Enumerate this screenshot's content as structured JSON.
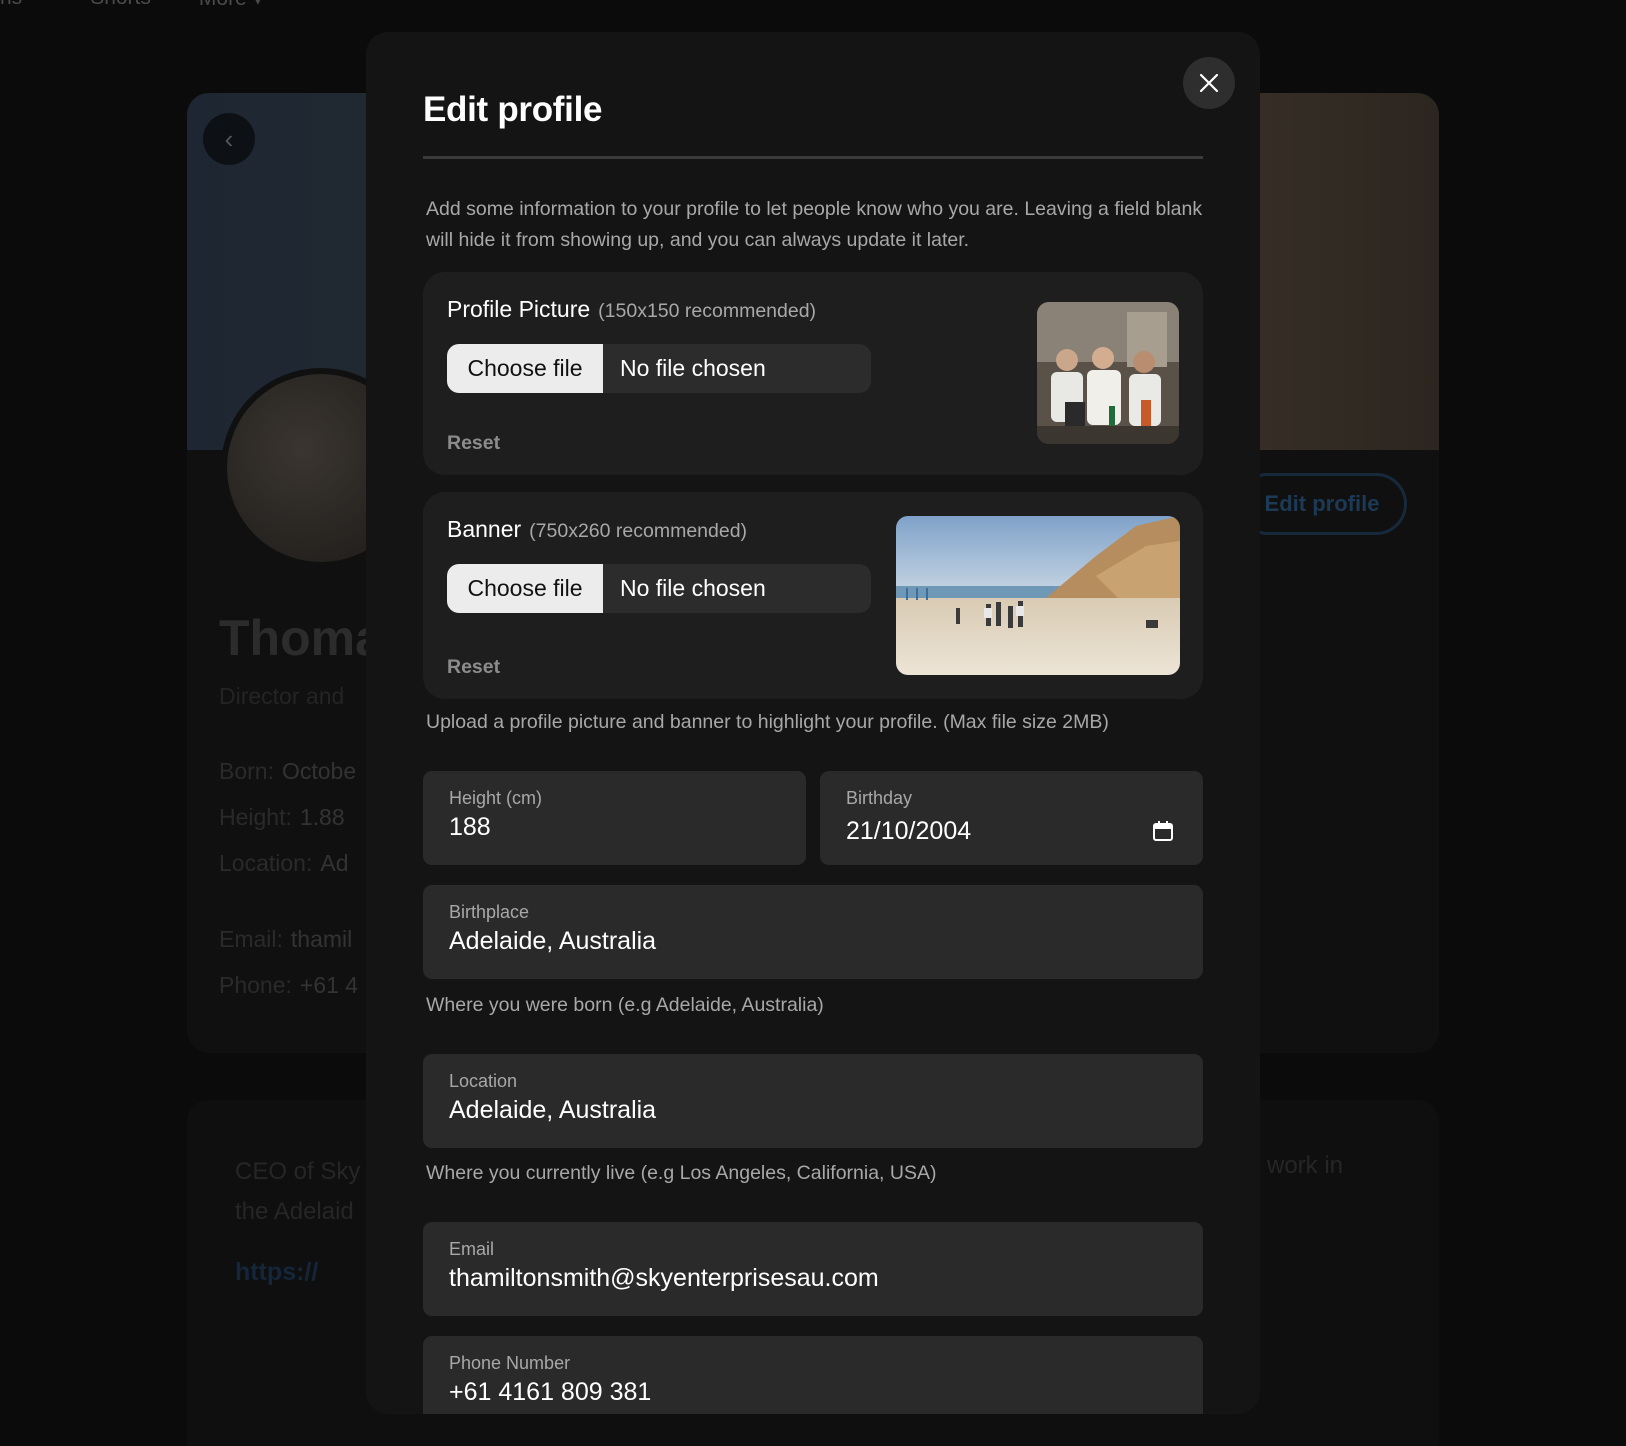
{
  "background": {
    "nav": [
      "ns",
      "Shorts",
      "More ▾"
    ],
    "profile": {
      "name": "Thoma",
      "subtitle": "Director and",
      "edit_button": "Edit profile",
      "rows": [
        {
          "label": "Born:",
          "value": "Octobe"
        },
        {
          "label": "Height:",
          "value": "1.88"
        },
        {
          "label": "Location:",
          "value": "Ad"
        },
        {
          "label": "Email:",
          "value": "thamil"
        },
        {
          "label": "Phone:",
          "value": "+61 4"
        }
      ],
      "bio_line1": "CEO of Sky",
      "bio_line2": "the Adelaid",
      "bio_right": "work in",
      "link": "https://"
    }
  },
  "modal": {
    "title": "Edit profile",
    "intro": "Add some information to your profile to let people know who you are. Leaving a field blank will hide it from showing up, and you can always update it later.",
    "profile_picture": {
      "label": "Profile Picture",
      "recommended": "(150x150 recommended)",
      "choose_file": "Choose file",
      "status": "No file chosen",
      "reset": "Reset"
    },
    "banner": {
      "label": "Banner",
      "recommended": "(750x260 recommended)",
      "choose_file": "Choose file",
      "status": "No file chosen",
      "reset": "Reset"
    },
    "upload_help": "Upload a profile picture and banner to highlight your profile. (Max file size 2MB)",
    "fields": {
      "height": {
        "label": "Height (cm)",
        "value": "188"
      },
      "birthday": {
        "label": "Birthday",
        "value": "21/10/2004"
      },
      "birthplace": {
        "label": "Birthplace",
        "value": "Adelaide, Australia",
        "help": "Where you were born (e.g Adelaide, Australia)"
      },
      "location": {
        "label": "Location",
        "value": "Adelaide, Australia",
        "help": "Where you currently live (e.g Los Angeles, California, USA)"
      },
      "email": {
        "label": "Email",
        "value": "thamiltonsmith@skyenterprisesau.com"
      },
      "phone": {
        "label": "Phone Number",
        "value": "+61 4161 809 381"
      }
    }
  },
  "colors": {
    "modal_bg": "#141414",
    "card_bg": "#1e1e1e",
    "field_bg": "#2a2a2a",
    "muted_text": "#a8a8a8"
  }
}
